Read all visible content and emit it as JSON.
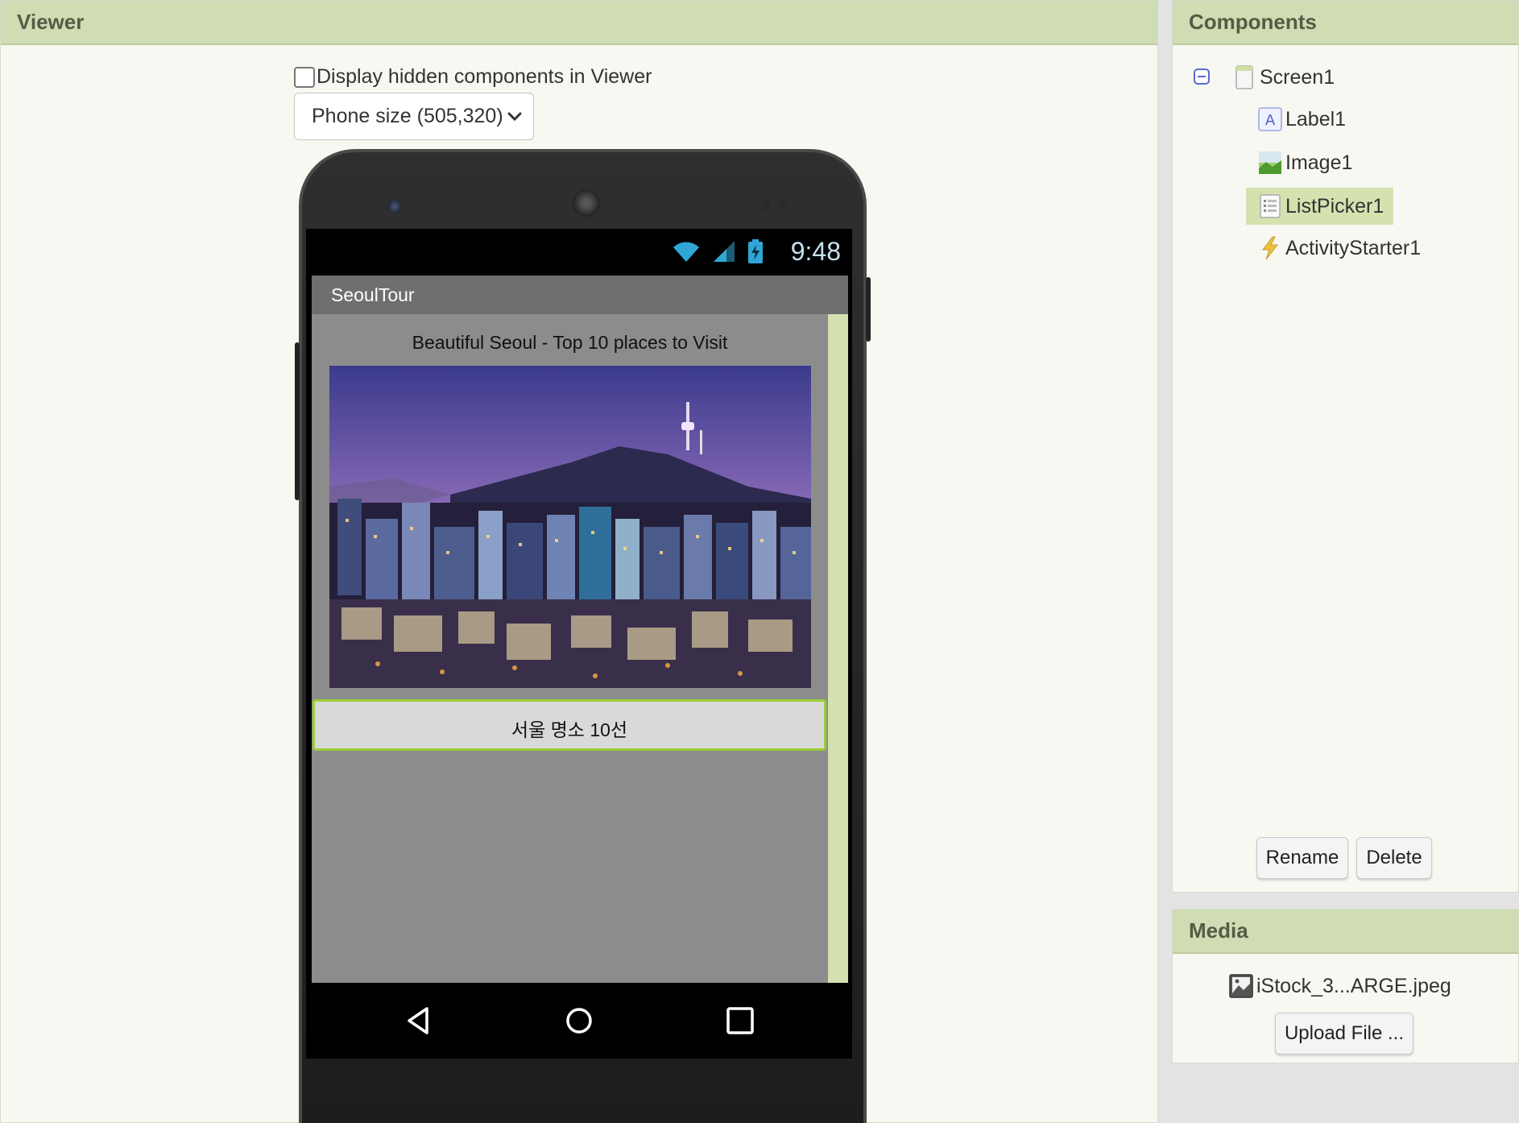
{
  "viewer": {
    "title": "Viewer",
    "hidden_components_label": "Display hidden components in Viewer",
    "size_select": "Phone size (505,320)"
  },
  "phone": {
    "status_time": "9:48",
    "app_title": "SeoulTour",
    "label1_text": "Beautiful Seoul - Top 10 places to Visit",
    "listpicker_text": "서울 명소 10선"
  },
  "components": {
    "title": "Components",
    "tree": {
      "root": "Screen1",
      "children": [
        "Label1",
        "Image1",
        "ListPicker1",
        "ActivityStarter1"
      ],
      "selected": "ListPicker1"
    },
    "rename_label": "Rename",
    "delete_label": "Delete"
  },
  "media": {
    "title": "Media",
    "file_name": "iStock_3...ARGE.jpeg",
    "upload_label": "Upload File ..."
  },
  "colors": {
    "header_bg": "#cfdcb4",
    "panel_bg": "#f7f8f2",
    "selection": "#d5e2b0",
    "listpicker_border": "#9acd32"
  }
}
